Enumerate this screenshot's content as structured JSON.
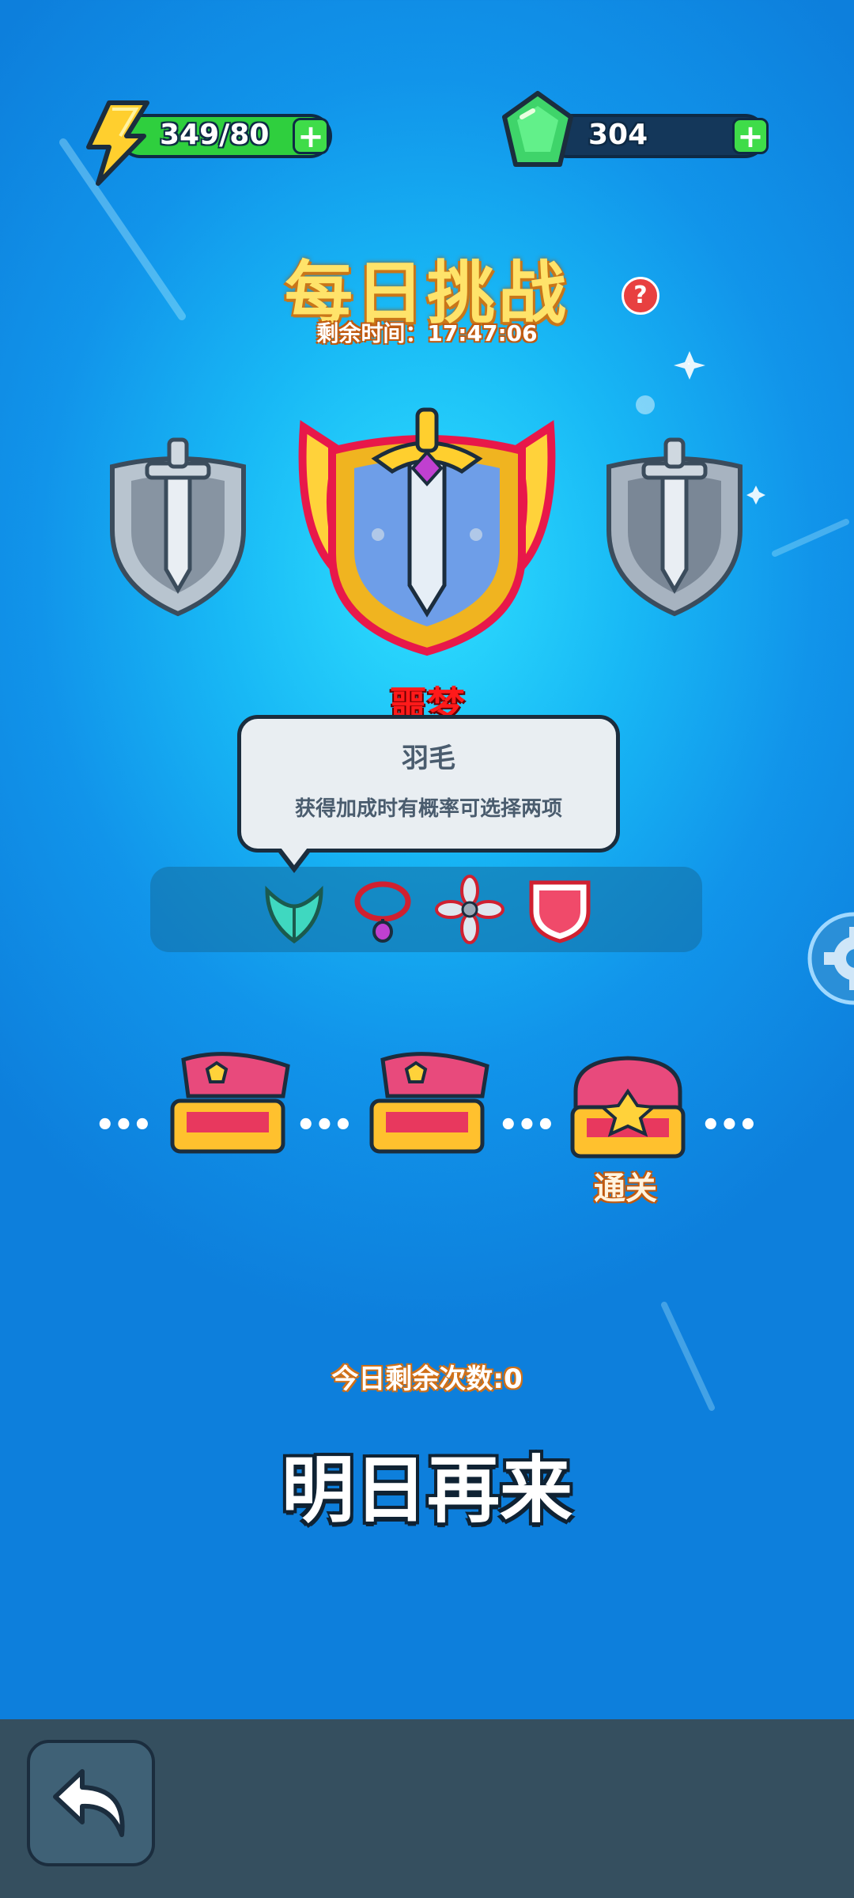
{
  "resources": {
    "energy": {
      "value": "349/80",
      "icon": "lightning-icon",
      "plus": "+"
    },
    "gems": {
      "value": "304",
      "icon": "gem-icon",
      "plus": "+"
    }
  },
  "header": {
    "title": "每日挑战",
    "timer": "剩余时间：17:47:06",
    "help": "?"
  },
  "difficulty": {
    "selected_label": "噩梦",
    "options": [
      "easy-shield",
      "nightmare-shield",
      "hard-shield"
    ]
  },
  "tooltip": {
    "title": "羽毛",
    "description": "获得加成时有概率可选择两项"
  },
  "buffs": [
    {
      "name": "feather-icon"
    },
    {
      "name": "necklace-icon"
    },
    {
      "name": "propeller-icon"
    },
    {
      "name": "shield-icon"
    }
  ],
  "rewards": {
    "clear_label": "通关"
  },
  "footer": {
    "remaining_attempts": "今日剩余次数:0",
    "come_back": "明日再来"
  },
  "colors": {
    "background": "#1194ea",
    "energy_bar": "#2fcf3e",
    "gem_bar": "#14375a",
    "title": "#ffe36a",
    "difficulty": "#ff1a1a",
    "bottom_bar": "#354f5f"
  }
}
